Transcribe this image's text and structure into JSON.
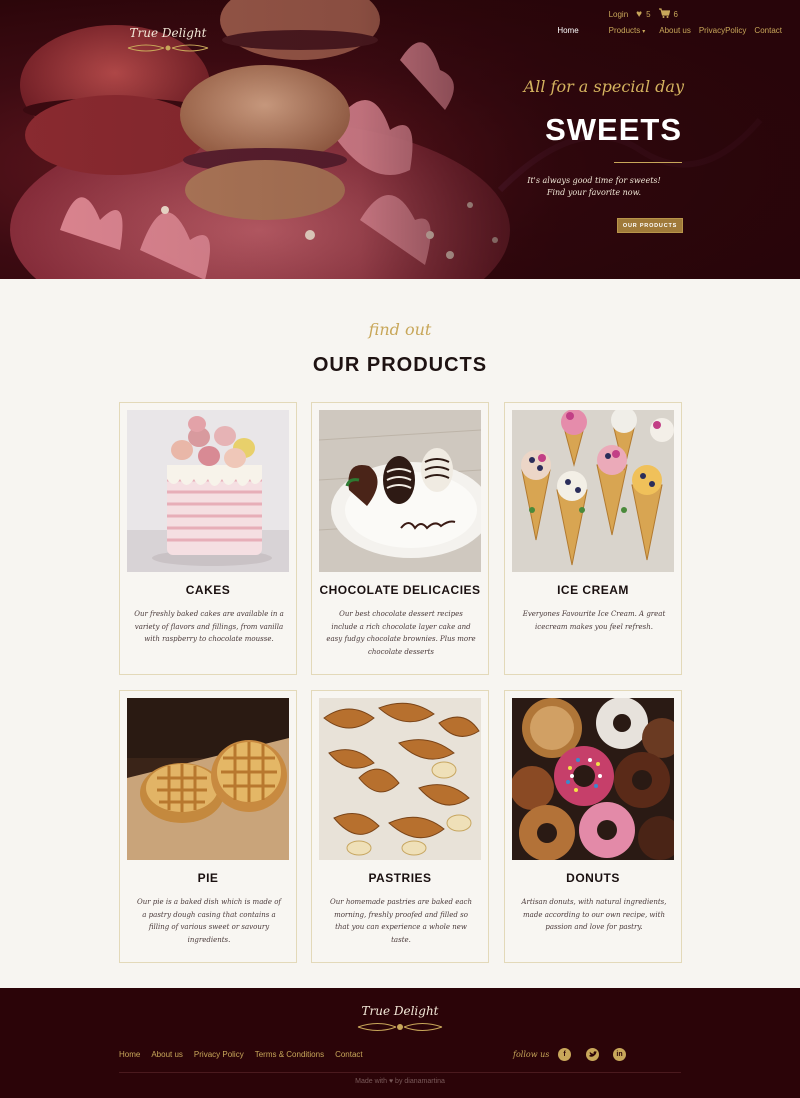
{
  "brand": {
    "name": "True Delight"
  },
  "topbar": {
    "login": "Login",
    "wishlist_count": "5",
    "cart_count": "6"
  },
  "nav": {
    "home": "Home",
    "products": "Products",
    "about": "About us",
    "privacy": "PrivacyPolicy",
    "contact": "Contact"
  },
  "hero": {
    "tagline": "All for a special day",
    "title": "SWEETS",
    "desc_line1": "It's always good time for sweets!",
    "desc_line2": "Find your favorite now.",
    "button": "OUR PRODUCTS"
  },
  "products_section": {
    "kicker": "find out",
    "title": "OUR PRODUCTS",
    "items": [
      {
        "title": "CAKES",
        "desc": "Our freshly baked cakes are available in a variety of flavors and fillings, from vanilla with raspberry to chocolate mousse."
      },
      {
        "title": "CHOCOLATE DELICACIES",
        "desc": "Our best chocolate dessert recipes include a rich chocolate layer cake and easy fudgy chocolate brownies. Plus more chocolate desserts"
      },
      {
        "title": "ICE CREAM",
        "desc": "Everyones Favourite Ice Cream. A great icecream makes you feel refresh."
      },
      {
        "title": "PIE",
        "desc": "Our pie is a baked dish which is made of a pastry dough casing that contains a filling of various sweet or savoury ingredients."
      },
      {
        "title": "PASTRIES",
        "desc": "Our homemade pastries are baked each morning, freshly proofed and filled so that you can experience a whole new taste."
      },
      {
        "title": "DONUTS",
        "desc": "Artisan donuts, with natural ingredients, made according to our own recipe, with passion and love for pastry."
      }
    ]
  },
  "footer": {
    "links": [
      "Home",
      "About us",
      "Privacy Policy",
      "Terms & Conditions",
      "Contact"
    ],
    "follow": "follow us",
    "credit": "Made with ♥ by dianamartina"
  },
  "colors": {
    "gold": "#c8a75a",
    "maroon": "#2b0408",
    "background": "#f7f5f1"
  }
}
